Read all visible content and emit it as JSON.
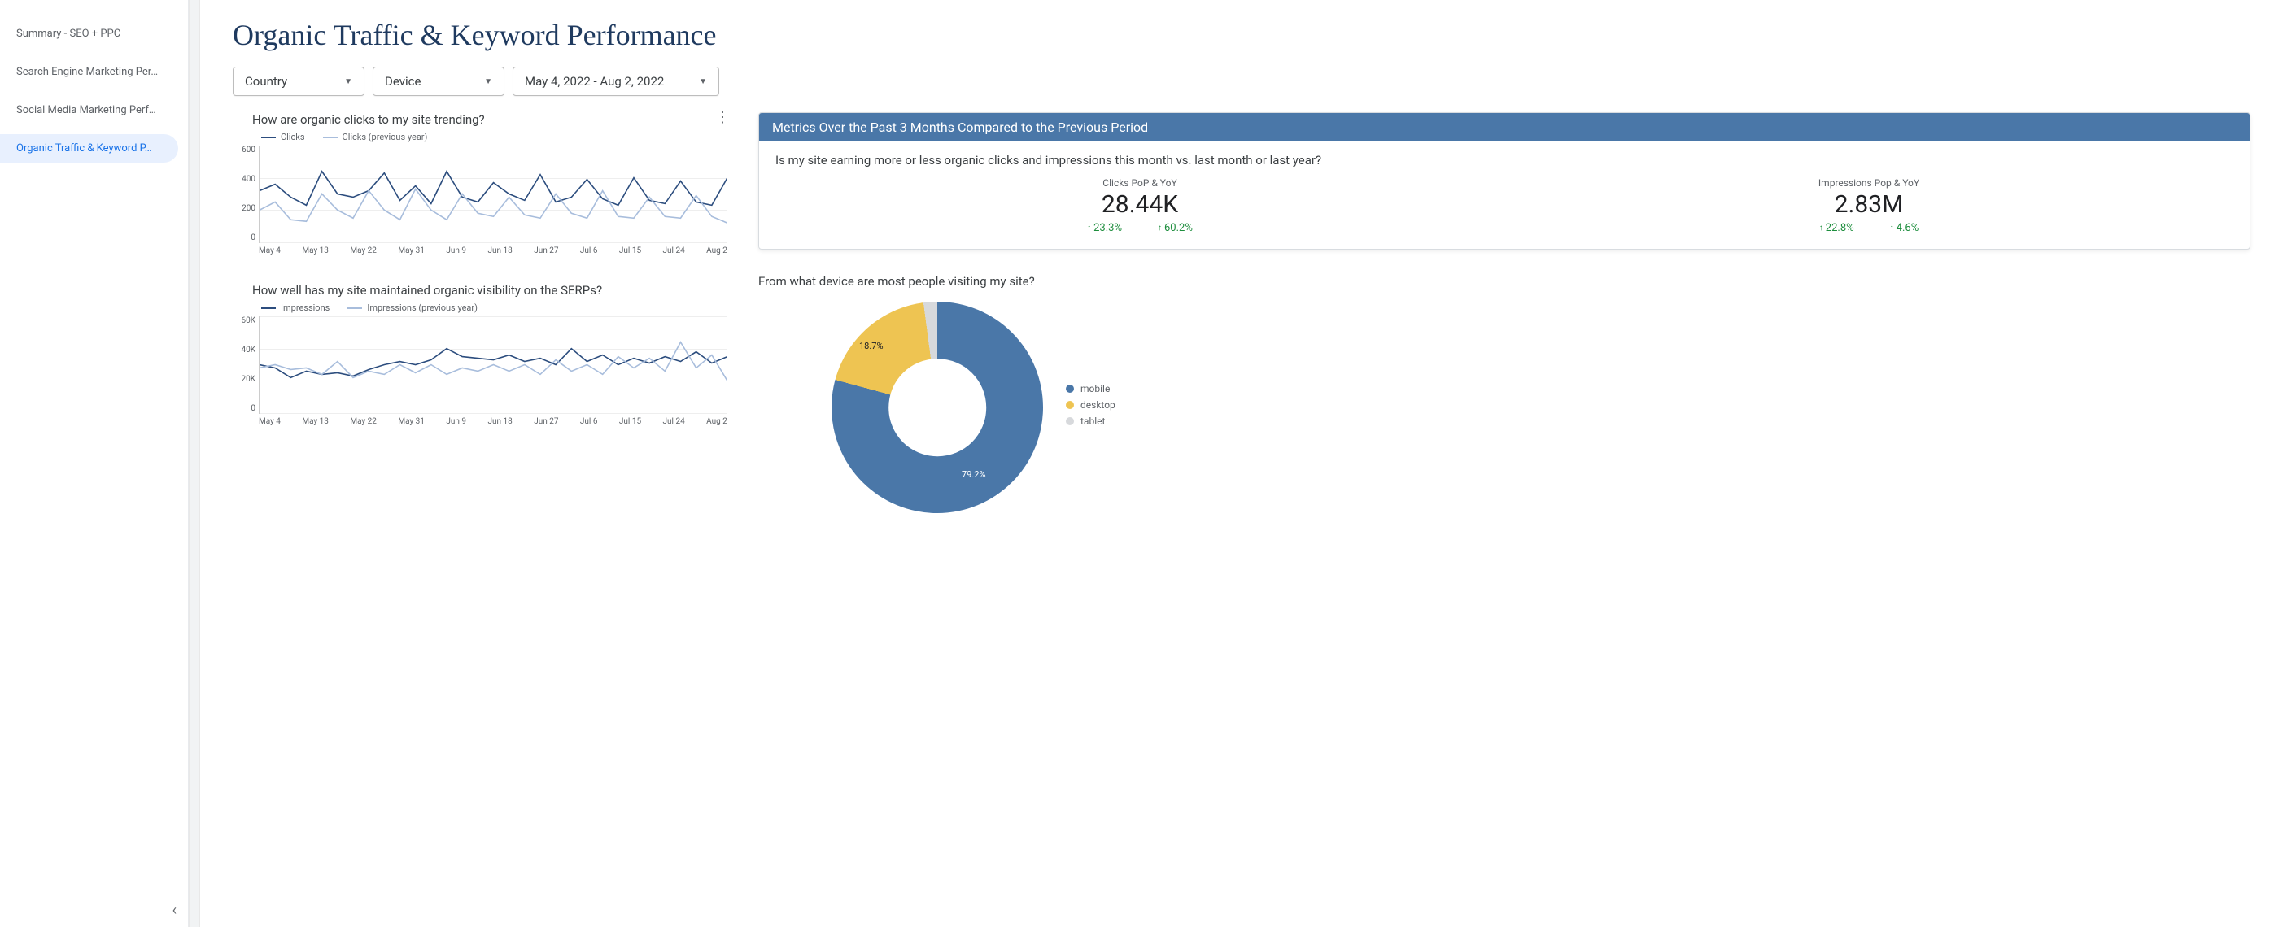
{
  "sidebar": {
    "items": [
      {
        "label": "Summary - SEO + PPC"
      },
      {
        "label": "Search Engine Marketing Per…"
      },
      {
        "label": "Social Media Marketing Perf…"
      },
      {
        "label": "Organic Traffic & Keyword P…"
      }
    ],
    "active_index": 3
  },
  "page_title": "Organic Traffic & Keyword Performance",
  "filters": {
    "country_label": "Country",
    "device_label": "Device",
    "date_range": "May 4, 2022 - Aug 2, 2022"
  },
  "clicks_chart": {
    "title": "How are organic clicks to my site trending?",
    "legend_current": "Clicks",
    "legend_prev": "Clicks (previous year)"
  },
  "impressions_chart": {
    "title": "How well has my site maintained organic visibility on the SERPs?",
    "legend_current": "Impressions",
    "legend_prev": "Impressions (previous year)"
  },
  "metrics_card": {
    "header": "Metrics Over the Past 3 Months Compared to the Previous Period",
    "question": "Is my site earning more or less organic clicks and impressions this month vs. last month or last year?",
    "clicks": {
      "label": "Clicks PoP & YoY",
      "value": "28.44K",
      "pop": "23.3%",
      "yoy": "60.2%"
    },
    "impressions": {
      "label": "Impressions Pop & YoY",
      "value": "2.83M",
      "pop": "22.8%",
      "yoy": "4.6%"
    }
  },
  "device_chart": {
    "title": "From what device are most people visiting my site?",
    "slice_label_desktop": "18.7%",
    "slice_label_mobile": "79.2%",
    "legend": {
      "mobile": "mobile",
      "desktop": "desktop",
      "tablet": "tablet"
    }
  },
  "chart_data": [
    {
      "type": "line",
      "title": "How are organic clicks to my site trending?",
      "xlabel": "",
      "ylabel": "",
      "ylim": [
        0,
        600
      ],
      "y_ticks": [
        0,
        200,
        400,
        600
      ],
      "x_ticks": [
        "May 4",
        "May 13",
        "May 22",
        "May 31",
        "Jun 9",
        "Jun 18",
        "Jun 27",
        "Jul 6",
        "Jul 15",
        "Jul 24",
        "Aug 2"
      ],
      "series": [
        {
          "name": "Clicks",
          "color": "#2c4d7e",
          "values": [
            320,
            360,
            280,
            230,
            440,
            300,
            280,
            320,
            430,
            260,
            350,
            240,
            440,
            280,
            250,
            370,
            300,
            260,
            420,
            250,
            280,
            390,
            270,
            230,
            400,
            260,
            240,
            380,
            250,
            230,
            400
          ]
        },
        {
          "name": "Clicks (previous year)",
          "color": "#a8bddc",
          "values": [
            200,
            250,
            140,
            130,
            300,
            200,
            150,
            320,
            200,
            140,
            330,
            200,
            140,
            300,
            180,
            160,
            280,
            170,
            150,
            300,
            180,
            150,
            320,
            160,
            150,
            280,
            160,
            150,
            290,
            160,
            120
          ]
        }
      ]
    },
    {
      "type": "line",
      "title": "How well has my site maintained organic visibility on the SERPs?",
      "xlabel": "",
      "ylabel": "",
      "ylim": [
        0,
        60000
      ],
      "y_ticks": [
        0,
        20000,
        40000,
        60000
      ],
      "y_tick_labels": [
        "0",
        "20K",
        "40K",
        "60K"
      ],
      "x_ticks": [
        "May 4",
        "May 13",
        "May 22",
        "May 31",
        "Jun 9",
        "Jun 18",
        "Jun 27",
        "Jul 6",
        "Jul 15",
        "Jul 24",
        "Aug 2"
      ],
      "series": [
        {
          "name": "Impressions",
          "color": "#2c4d7e",
          "values": [
            30000,
            28000,
            22000,
            26000,
            24000,
            25000,
            23000,
            27000,
            30000,
            32000,
            30000,
            33000,
            40000,
            35000,
            34000,
            33000,
            36000,
            32000,
            34000,
            30000,
            40000,
            32000,
            36000,
            30000,
            34000,
            31000,
            35000,
            32000,
            38000,
            31000,
            35000
          ]
        },
        {
          "name": "Impressions (previous year)",
          "color": "#a8bddc",
          "values": [
            28000,
            30000,
            27000,
            28000,
            24000,
            32000,
            22000,
            26000,
            24000,
            30000,
            25000,
            30000,
            24000,
            28000,
            26000,
            30000,
            26000,
            30000,
            24000,
            33000,
            26000,
            30000,
            24000,
            35000,
            28000,
            34000,
            26000,
            44000,
            28000,
            36000,
            20000
          ]
        }
      ]
    },
    {
      "type": "pie",
      "title": "From what device are most people visiting my site?",
      "categories": [
        "mobile",
        "desktop",
        "tablet"
      ],
      "values": [
        79.2,
        18.7,
        2.1
      ],
      "colors": [
        "#4a77a8",
        "#eec452",
        "#d7d9dc"
      ]
    }
  ]
}
